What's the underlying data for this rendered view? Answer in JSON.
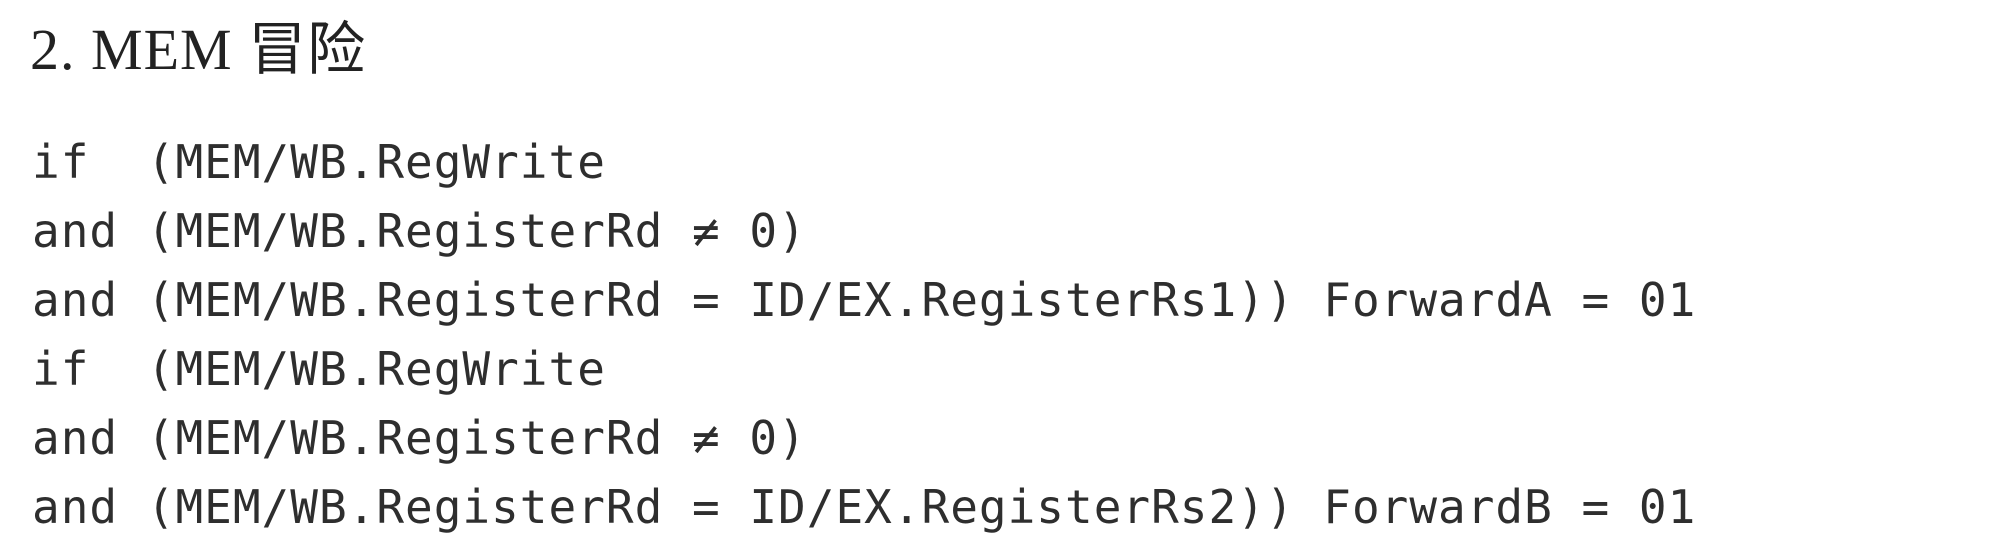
{
  "heading": "2. MEM 冒险",
  "code_lines": [
    "if  (MEM/WB.RegWrite",
    "and (MEM/WB.RegisterRd ≠ 0)",
    "and (MEM/WB.RegisterRd = ID/EX.RegisterRs1)) ForwardA = 01",
    "if  (MEM/WB.RegWrite",
    "and (MEM/WB.RegisterRd ≠ 0)",
    "and (MEM/WB.RegisterRd = ID/EX.RegisterRs2)) ForwardB = 01"
  ]
}
